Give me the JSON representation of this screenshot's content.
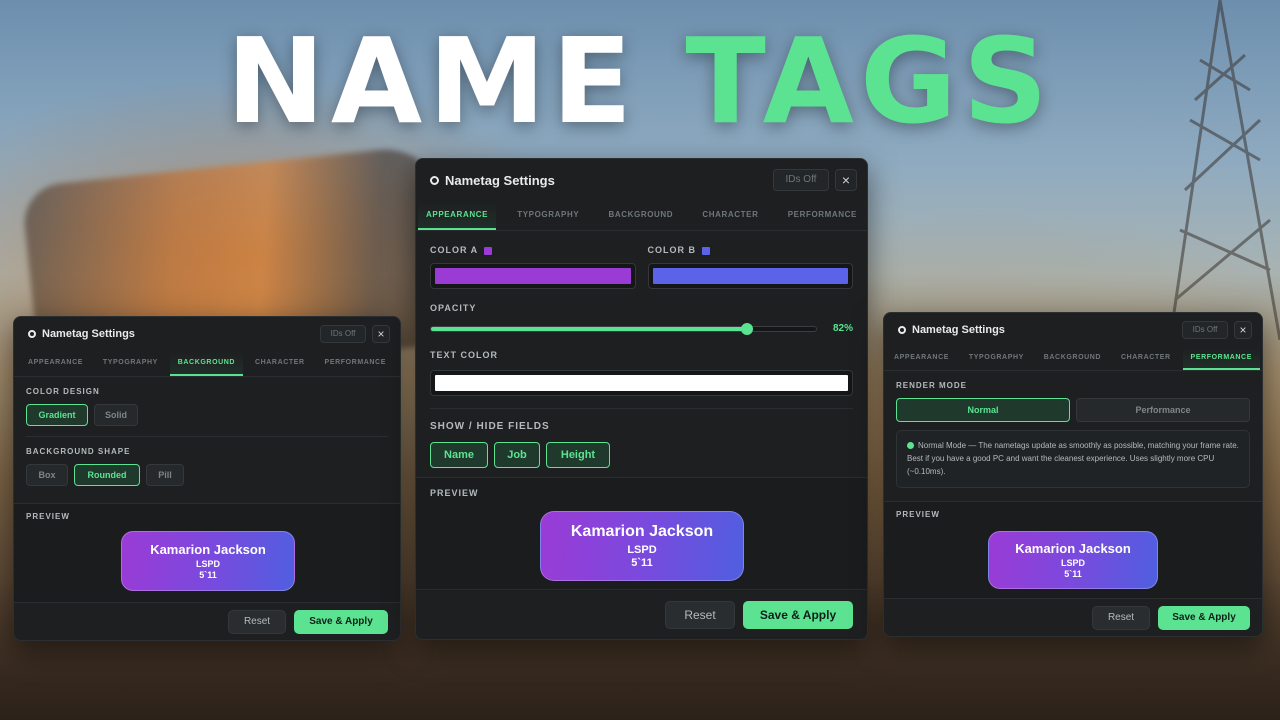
{
  "headline": {
    "word1": "NAME",
    "word2": "TAGS"
  },
  "colors": {
    "accent": "#5be392",
    "color_a": "#9b3bd6",
    "color_b": "#5b63e8",
    "text_color": "#ffffff"
  },
  "panel_common": {
    "title": "Nametag Settings",
    "ids_label": "IDs Off",
    "close_icon": "×",
    "tabs": [
      "APPEARANCE",
      "TYPOGRAPHY",
      "BACKGROUND",
      "CHARACTER",
      "PERFORMANCE"
    ],
    "preview_label": "PREVIEW",
    "reset_label": "Reset",
    "save_label": "Save & Apply",
    "tag_name": "Kamarion Jackson",
    "tag_job": "LSPD",
    "tag_height": "5`11"
  },
  "left_panel": {
    "active_tab": "BACKGROUND",
    "color_design_label": "COLOR DESIGN",
    "color_design_options": [
      "Gradient",
      "Solid"
    ],
    "color_design_selected": "Gradient",
    "shape_label": "BACKGROUND SHAPE",
    "shape_options": [
      "Box",
      "Rounded",
      "Pill"
    ],
    "shape_selected": "Rounded"
  },
  "center_panel": {
    "active_tab": "APPEARANCE",
    "color_a_label": "COLOR A",
    "color_b_label": "COLOR B",
    "opacity_label": "OPACITY",
    "opacity_value": 82,
    "opacity_text": "82%",
    "text_color_label": "TEXT COLOR",
    "fields_label": "SHOW / HIDE FIELDS",
    "fields": [
      "Name",
      "Job",
      "Height"
    ]
  },
  "right_panel": {
    "active_tab": "PERFORMANCE",
    "render_mode_label": "RENDER MODE",
    "render_modes": [
      "Normal",
      "Performance"
    ],
    "render_mode_selected": "Normal",
    "info_text": "Normal Mode — The nametags update as smoothly as possible, matching your frame rate. Best if you have a good PC and want the cleanest experience. Uses slightly more CPU (~0.10ms)."
  }
}
